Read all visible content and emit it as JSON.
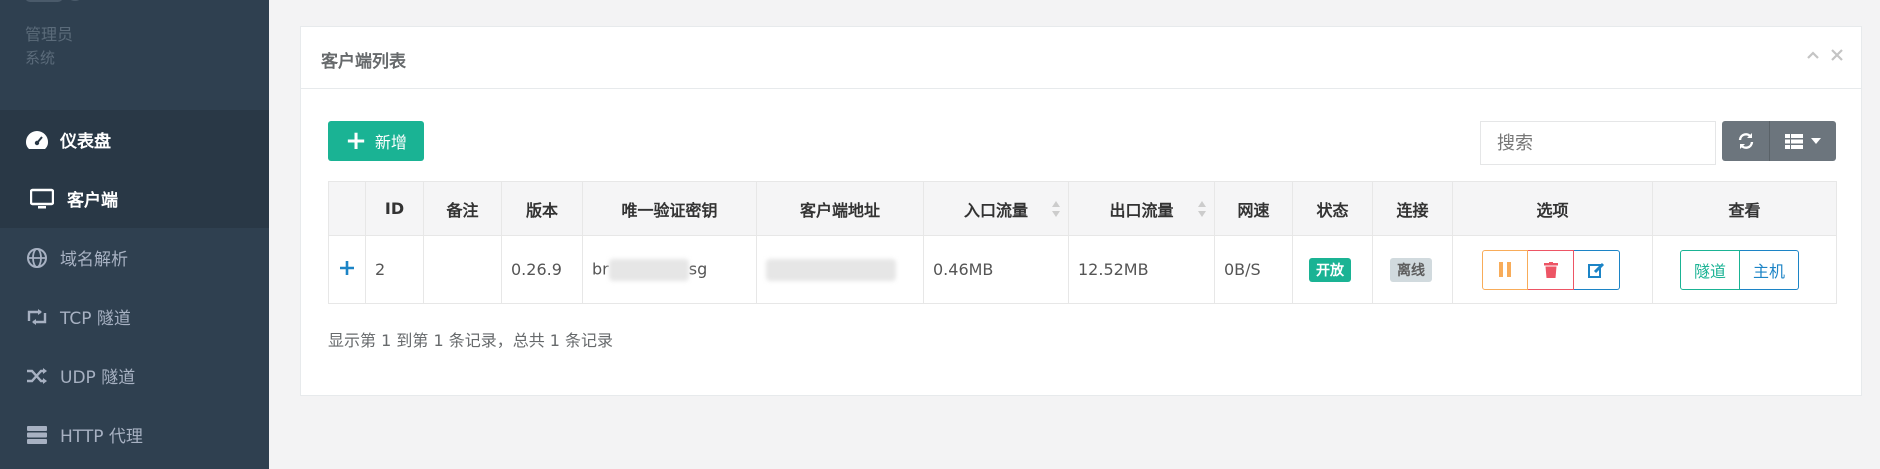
{
  "sidebar": {
    "profile": {
      "name": "管理员",
      "role": "系统"
    },
    "items": [
      {
        "label": "仪表盘",
        "icon": "dashboard-icon"
      },
      {
        "label": "客户端",
        "icon": "monitor-icon"
      },
      {
        "label": "域名解析",
        "icon": "globe-icon"
      },
      {
        "label": "TCP 隧道",
        "icon": "retweet-icon"
      },
      {
        "label": "UDP 隧道",
        "icon": "random-icon"
      },
      {
        "label": "HTTP 代理",
        "icon": "server-icon"
      }
    ]
  },
  "panel": {
    "title": "客户端列表",
    "add_label": "新增",
    "search_placeholder": "搜索"
  },
  "table": {
    "headers": [
      "ID",
      "备注",
      "版本",
      "唯一验证密钥",
      "客户端地址",
      "入口流量",
      "出口流量",
      "网速",
      "状态",
      "连接",
      "选项",
      "查看"
    ],
    "rows": [
      {
        "id": "2",
        "remark": "",
        "version": "0.26.9",
        "key_start": "br",
        "key_end": "sg",
        "address": "",
        "in_flow": "0.46MB",
        "out_flow": "12.52MB",
        "speed": "0B/S",
        "status": "开放",
        "conn": "离线",
        "view_tunnel": "隧道",
        "view_host": "主机"
      }
    ]
  },
  "footer": {
    "summary": "显示第 1 到第 1 条记录，总共 1 条记录"
  },
  "colors": {
    "sidebar": "#2f4050",
    "primary": "#1ab394",
    "warning": "#f8ac59",
    "danger": "#ed5565",
    "info": "#1c84c6"
  }
}
